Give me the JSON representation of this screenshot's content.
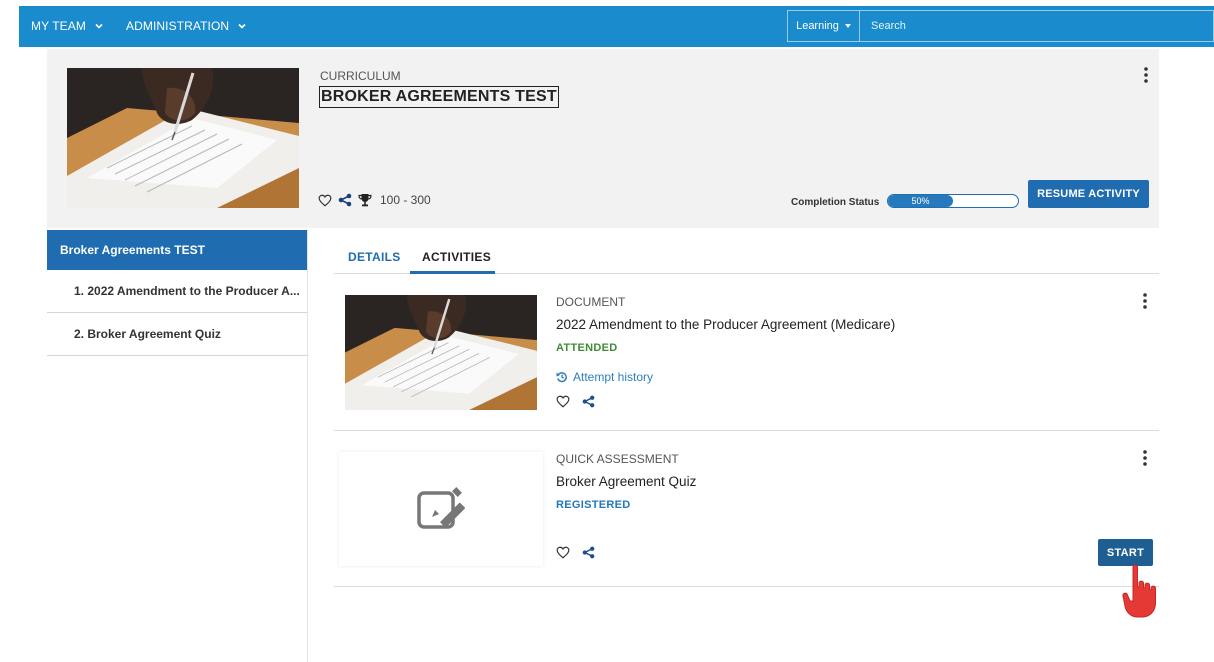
{
  "nav": {
    "my_team": "MY TEAM",
    "administration": "ADMINISTRATION",
    "search_scope": "Learning",
    "search_placeholder": "Search"
  },
  "header": {
    "type": "CURRICULUM",
    "title": "BROKER AGREEMENTS TEST",
    "points": "100 - 300",
    "completion_label": "Completion Status",
    "completion_percent": 50,
    "completion_text": "50%",
    "resume_label": "RESUME ACTIVITY"
  },
  "sidebar": {
    "active": "Broker Agreements TEST",
    "items": [
      {
        "label": "1. 2022 Amendment to the Producer A..."
      },
      {
        "label": "2. Broker Agreement Quiz"
      }
    ]
  },
  "tabs": [
    {
      "label": "DETAILS"
    },
    {
      "label": "ACTIVITIES"
    }
  ],
  "activities": [
    {
      "type": "DOCUMENT",
      "title": "2022 Amendment to the Producer Agreement (Medicare)",
      "status": "ATTENDED",
      "attempt_history": "Attempt history"
    },
    {
      "type": "QUICK ASSESSMENT",
      "title": "Broker Agreement Quiz",
      "status": "REGISTERED",
      "start_label": "START"
    }
  ],
  "colors": {
    "nav_blue": "#1a8ccd",
    "primary": "#1f6db0",
    "attended": "#3f8b3a",
    "registered": "#2477bc"
  },
  "icons": [
    "chevron-down-icon",
    "heart-icon",
    "share-icon",
    "trophy-icon",
    "kebab-menu-icon",
    "history-icon",
    "edit-icon",
    "hand-pointer-icon"
  ]
}
